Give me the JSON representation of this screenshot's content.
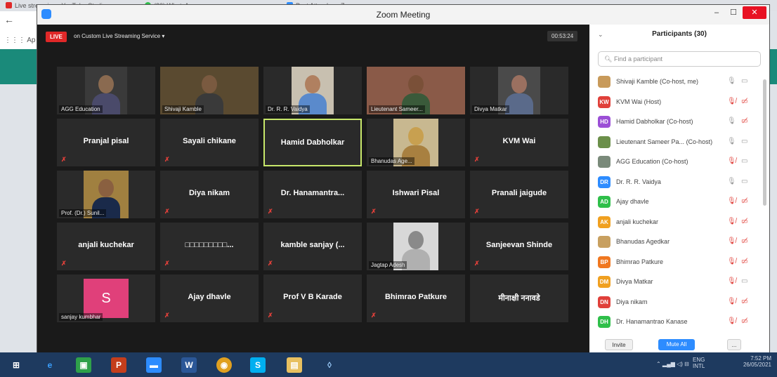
{
  "browser": {
    "tabs": [
      "Live streaming - YouTube Studio",
      "(20) WhatsApp",
      "Post Attendee - Zoom"
    ],
    "apps_label": "Ap"
  },
  "window": {
    "title": "Zoom Meeting"
  },
  "toolbar": {
    "live_label": "LIVE",
    "stream_label": "on Custom Live Streaming Service",
    "timer": "00:53:24"
  },
  "gallery": [
    {
      "name": "AGG Education",
      "type": "video",
      "muted": true
    },
    {
      "name": "Shivaji Kamble",
      "type": "video",
      "muted": false
    },
    {
      "name": "Dr. R. R. Vaidya",
      "type": "video",
      "muted": false
    },
    {
      "name": "Lieutenant Sameer...",
      "type": "video",
      "muted": false
    },
    {
      "name": "Divya Matkar",
      "type": "video",
      "muted": true
    },
    {
      "name": "Pranjal pisal",
      "type": "name",
      "muted": true
    },
    {
      "name": "Sayali chikane",
      "type": "name",
      "muted": true
    },
    {
      "name": "Hamid Dabholkar",
      "type": "name",
      "muted": false,
      "active": true
    },
    {
      "name": "Bhanudas Age...",
      "type": "video",
      "muted": true
    },
    {
      "name": "KVM Wai",
      "type": "name",
      "muted": true
    },
    {
      "name": "Prof. (Dr.) Sunil...",
      "type": "video",
      "muted": true
    },
    {
      "name": "Diya nikam",
      "type": "name",
      "muted": true
    },
    {
      "name": "Dr. Hanamantra...",
      "type": "name",
      "muted": true
    },
    {
      "name": "Ishwari Pisal",
      "type": "name",
      "muted": true
    },
    {
      "name": "Pranali jaigude",
      "type": "name",
      "muted": true
    },
    {
      "name": "anjali kuchekar",
      "type": "name",
      "muted": true
    },
    {
      "name": "□□□□□□□□□...",
      "type": "name",
      "muted": true
    },
    {
      "name": "kamble sanjay (...",
      "type": "name",
      "muted": true
    },
    {
      "name": "Jagtap Adesh",
      "type": "video",
      "muted": true
    },
    {
      "name": "Sanjeevan Shinde",
      "type": "name",
      "muted": true
    },
    {
      "name": "sanjay kumbhar",
      "type": "avatar",
      "initial": "S",
      "muted": true
    },
    {
      "name": "Ajay dhavle",
      "type": "name",
      "muted": true
    },
    {
      "name": "Prof V B Karade",
      "type": "name",
      "muted": true
    },
    {
      "name": "Bhimrao Patkure",
      "type": "name",
      "muted": true
    },
    {
      "name": "मीनाक्षी ननावडे",
      "type": "name",
      "muted": false
    }
  ],
  "participants": {
    "header": "Participants (30)",
    "search_placeholder": "Find a participant",
    "list": [
      {
        "name": "Shivaji Kamble (Co-host, me)",
        "initials": "",
        "color": "#c89a5a",
        "mic": "on",
        "cam": "on"
      },
      {
        "name": "KVM Wai (Host)",
        "initials": "KW",
        "color": "#e0403a",
        "mic": "off",
        "cam": "off"
      },
      {
        "name": "Hamid Dabholkar (Co-host)",
        "initials": "HD",
        "color": "#9b4fd6",
        "mic": "on",
        "cam": "off"
      },
      {
        "name": "Lieutenant Sameer Pa... (Co-host)",
        "initials": "",
        "color": "#6b8f4a",
        "mic": "on",
        "cam": "on"
      },
      {
        "name": "AGG Education (Co-host)",
        "initials": "",
        "color": "#7a8a7a",
        "mic": "off",
        "cam": "on"
      },
      {
        "name": "Dr. R. R. Vaidya",
        "initials": "DR",
        "color": "#2d8cff",
        "mic": "on",
        "cam": "on"
      },
      {
        "name": "Ajay dhavle",
        "initials": "AD",
        "color": "#2fbf4a",
        "mic": "off",
        "cam": "off"
      },
      {
        "name": "anjali kuchekar",
        "initials": "AK",
        "color": "#f0a020",
        "mic": "off",
        "cam": "off"
      },
      {
        "name": "Bhanudas Agedkar",
        "initials": "",
        "color": "#c8a060",
        "mic": "off",
        "cam": "off"
      },
      {
        "name": "Bhimrao Patkure",
        "initials": "BP",
        "color": "#f07820",
        "mic": "off",
        "cam": "off"
      },
      {
        "name": "Divya Matkar",
        "initials": "DM",
        "color": "#f0a020",
        "mic": "off",
        "cam": "on"
      },
      {
        "name": "Diya nikam",
        "initials": "DN",
        "color": "#e0403a",
        "mic": "off",
        "cam": "off"
      },
      {
        "name": "Dr. Hanamantrao Kanase",
        "initials": "DH",
        "color": "#2fbf4a",
        "mic": "off",
        "cam": "off"
      }
    ],
    "invite_label": "Invite",
    "mute_all_label": "Mute All",
    "more_label": "..."
  },
  "taskbar": {
    "lang_top": "ENG",
    "lang_bottom": "INTL",
    "time": "7:52 PM",
    "date": "26/05/2021"
  }
}
